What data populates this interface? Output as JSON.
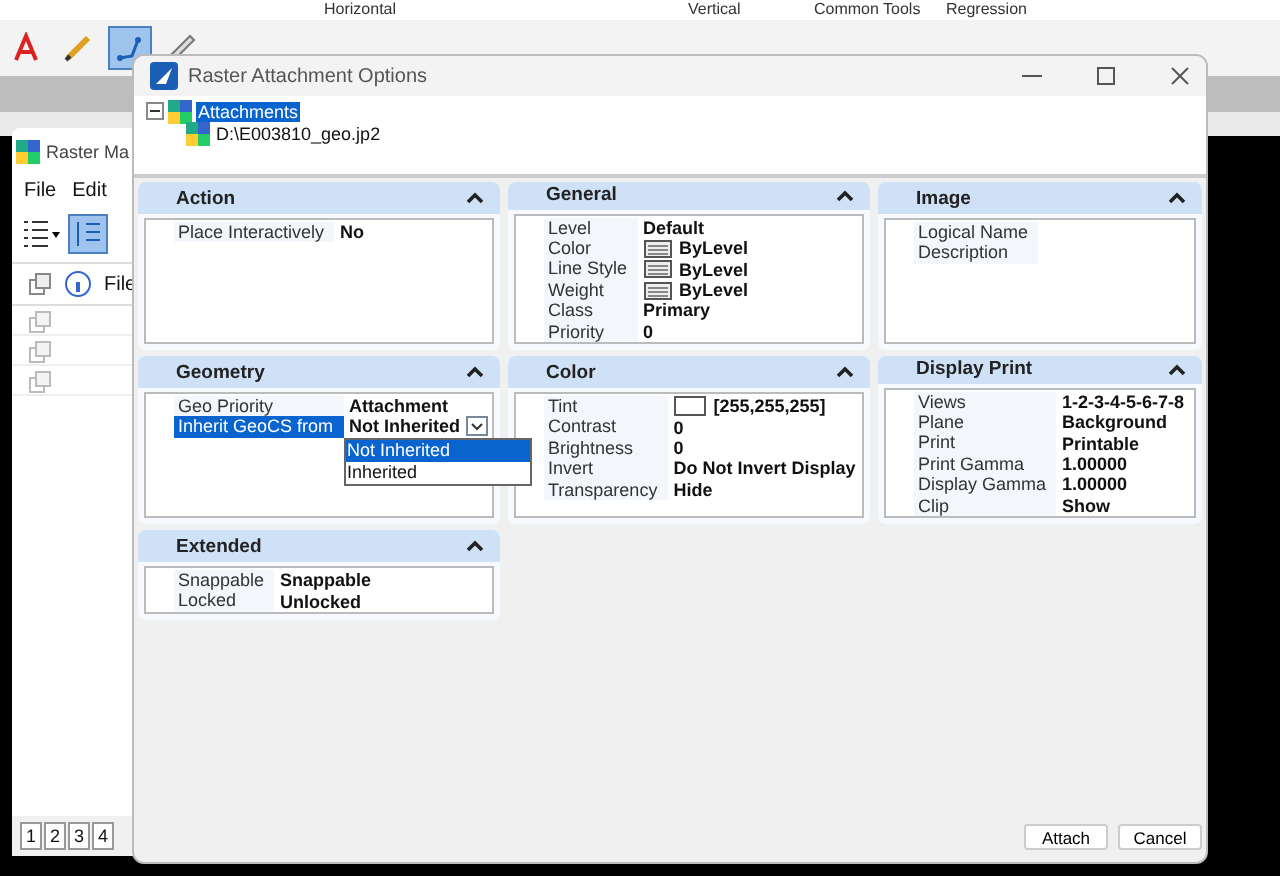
{
  "background_header": {
    "columns": [
      "Horizontal",
      "Vertical",
      "Common Tools",
      "Regression"
    ]
  },
  "toolbar": {
    "tools": [
      {
        "kind": "text",
        "selected": false
      },
      {
        "kind": "pencil",
        "selected": false
      },
      {
        "kind": "line",
        "selected": true
      },
      {
        "kind": "ruler",
        "selected": false
      }
    ]
  },
  "background_window": {
    "title": "Raster Ma",
    "menu": [
      "File",
      "Edit"
    ],
    "list_header": "File",
    "page_tabs": [
      "1",
      "2",
      "3",
      "4"
    ]
  },
  "dialog": {
    "title": "Raster Attachment Options",
    "tree": [
      {
        "label": "Attachments",
        "selected": true,
        "expanded": true,
        "children": [
          {
            "label": "D:\\E003810_geo.jp2",
            "selected": false
          }
        ]
      }
    ],
    "panels": [
      {
        "title": "Action",
        "expanded": true,
        "rows": [
          {
            "kind": "text",
            "label": "Place Interactively",
            "value": "No"
          }
        ]
      },
      {
        "title": "General",
        "expanded": true,
        "rows": [
          {
            "kind": "text",
            "label": "Level",
            "value": "Default"
          },
          {
            "kind": "symbology",
            "label": "Color",
            "value": "ByLevel"
          },
          {
            "kind": "symbology",
            "label": "Line Style",
            "value": "ByLevel"
          },
          {
            "kind": "symbology",
            "label": "Weight",
            "value": "ByLevel"
          },
          {
            "kind": "text",
            "label": "Class",
            "value": "Primary"
          },
          {
            "kind": "text",
            "label": "Priority",
            "value": "0"
          }
        ]
      },
      {
        "title": "Image",
        "expanded": true,
        "rows": [
          {
            "kind": "text",
            "label": "Logical Name"
          },
          {
            "kind": "text",
            "label": "Description"
          }
        ]
      },
      {
        "title": "Geometry",
        "expanded": true,
        "rows": [
          {
            "kind": "text",
            "label": "Geo Priority",
            "value": "Attachment"
          },
          {
            "kind": "dropdown",
            "label": "Inherit GeoCS from",
            "value": "Not Inherited",
            "selected": true,
            "open": true,
            "options": [
              {
                "label": "Not Inherited",
                "selected": true
              },
              {
                "label": "Inherited",
                "selected": false
              }
            ]
          }
        ]
      },
      {
        "title": "Color",
        "expanded": true,
        "rows": [
          {
            "kind": "swatch",
            "label": "Tint",
            "value": "[255,255,255]",
            "color": "#ffffff"
          },
          {
            "kind": "text",
            "label": "Contrast",
            "value": "0"
          },
          {
            "kind": "text",
            "label": "Brightness",
            "value": "0"
          },
          {
            "kind": "text",
            "label": "Invert",
            "value": "Do Not Invert Display"
          },
          {
            "kind": "text",
            "label": "Transparency",
            "value": "Hide"
          }
        ]
      },
      {
        "title": "Display Print",
        "expanded": true,
        "rows": [
          {
            "kind": "text",
            "label": "Views",
            "value": "1-2-3-4-5-6-7-8"
          },
          {
            "kind": "text",
            "label": "Plane",
            "value": "Background"
          },
          {
            "kind": "text",
            "label": "Print",
            "value": "Printable"
          },
          {
            "kind": "text",
            "label": "Print Gamma",
            "value": "1.00000"
          },
          {
            "kind": "text",
            "label": "Display Gamma",
            "value": "1.00000"
          },
          {
            "kind": "text",
            "label": "Clip",
            "value": "Show"
          }
        ]
      },
      {
        "title": "Extended",
        "expanded": true,
        "rows": [
          {
            "kind": "text",
            "label": "Snappable",
            "value": "Snappable"
          },
          {
            "kind": "text",
            "label": "Locked",
            "value": "Unlocked"
          }
        ]
      }
    ],
    "buttons": [
      "Attach",
      "Cancel"
    ]
  }
}
